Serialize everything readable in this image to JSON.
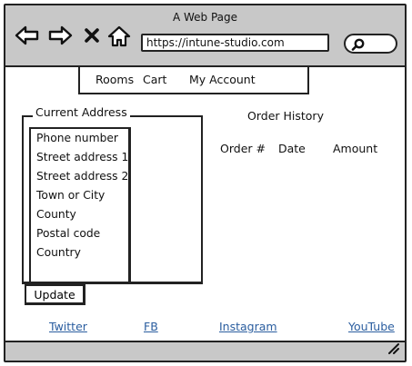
{
  "window": {
    "title": "A Web Page",
    "url": "https://intune-studio.com",
    "icons": [
      "back-arrow-icon",
      "forward-arrow-icon",
      "close-icon",
      "home-icon",
      "search-icon"
    ]
  },
  "menu": {
    "items": [
      {
        "label": "Rooms"
      },
      {
        "label": "Cart"
      },
      {
        "label": "My Account"
      }
    ]
  },
  "address": {
    "legend": "Current Address",
    "fields": [
      {
        "label": "Phone number"
      },
      {
        "label": "Street address 1"
      },
      {
        "label": "Street address 2"
      },
      {
        "label": "Town or City"
      },
      {
        "label": "County"
      },
      {
        "label": "Postal code"
      },
      {
        "label": "Country"
      }
    ],
    "update_label": "Update"
  },
  "orders": {
    "title": "Order History",
    "columns": [
      "Order #",
      "Date",
      "Amount"
    ]
  },
  "footer": {
    "links": [
      {
        "label": "Twitter"
      },
      {
        "label": "FB"
      },
      {
        "label": "Instagram"
      },
      {
        "label": "YouTube"
      }
    ]
  }
}
